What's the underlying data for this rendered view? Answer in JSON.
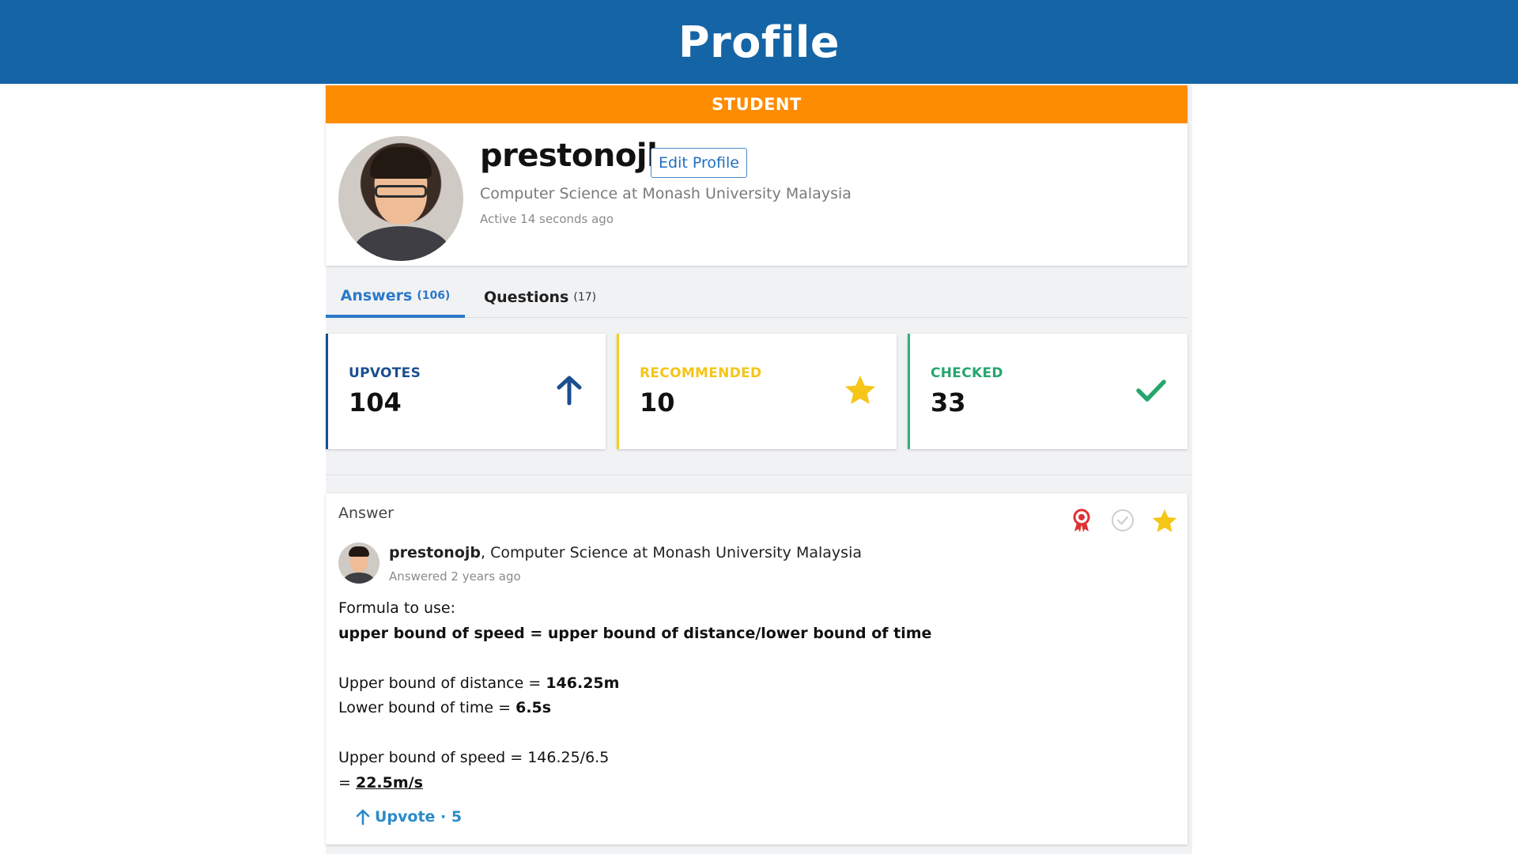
{
  "header": {
    "title": "Profile"
  },
  "profile": {
    "role": "STUDENT",
    "username": "prestonojb",
    "edit_label": "Edit Profile",
    "degree": "Computer Science at Monash University Malaysia",
    "active": "Active 14 seconds ago"
  },
  "tabs": [
    {
      "label": "Answers",
      "count": "(106)"
    },
    {
      "label": "Questions",
      "count": "(17)"
    }
  ],
  "stats": [
    {
      "label": "UPVOTES",
      "value": "104",
      "icon": "arrow-up-icon",
      "color": "#1b4f8f"
    },
    {
      "label": "RECOMMENDED",
      "value": "10",
      "icon": "star-icon",
      "color": "#f5c518"
    },
    {
      "label": "CHECKED",
      "value": "33",
      "icon": "checkmark-icon",
      "color": "#25a66e"
    }
  ],
  "answer": {
    "type_label": "Answer",
    "author": "prestonojb",
    "author_suffix": ", Computer Science at Monash University Malaysia",
    "answered": "Answered 2 years ago",
    "lines": {
      "l1": "Formula to use:",
      "l2": "upper bound of speed = upper bound of distance/lower bound of time",
      "l3_prefix": "Upper bound of distance = ",
      "l3_value": "146.25m",
      "l4_prefix": "Lower bound of time = ",
      "l4_value": "6.5s",
      "l5": "Upper bound of speed = 146.25/6.5",
      "l6_prefix": "= ",
      "l6_value": "22.5m/s"
    },
    "upvote_label": "Upvote · 5",
    "badges": [
      "award-ribbon-icon",
      "check-circle-icon",
      "star-icon"
    ]
  }
}
